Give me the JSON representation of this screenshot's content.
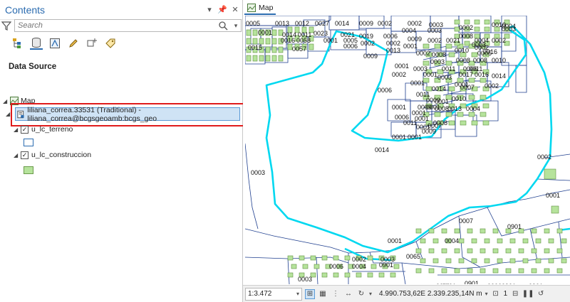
{
  "contents": {
    "title": "Contents",
    "search_placeholder": "Search",
    "section_title": "Data Source",
    "tree": {
      "map_label": "Map",
      "source_label": "liliana_correa.33531 (Traditional) - liliana_correa@bcgsgeoamb:bcgs_geo",
      "layers": [
        {
          "label": "u_lc_terreno",
          "checked": true,
          "symbol": "blue-outline-polygon"
        },
        {
          "label": "u_lc_construccion",
          "checked": true,
          "symbol": "green-fill-polygon"
        }
      ]
    }
  },
  "map": {
    "tab_label": "Map",
    "labels": [
      "0005",
      "0013",
      "0012",
      "0027",
      "0014",
      "0009",
      "0002",
      "0002",
      "0003",
      "0001",
      "0014",
      "0011",
      "0023",
      "0021",
      "0019",
      "0006",
      "0004",
      "0003",
      "0002",
      "0010",
      "0016",
      "0058",
      "0001",
      "0005",
      "0002",
      "0002",
      "0009",
      "0002",
      "0021",
      "0008",
      "0004",
      "0002",
      "0015",
      "0057",
      "0006",
      "0013",
      "0001",
      "0002",
      "0008",
      "0010",
      "0005",
      "0004",
      "0003",
      "0003",
      "0002",
      "0016",
      "0008",
      "0008",
      "0010",
      "0003",
      "0009",
      "0006",
      "0011",
      "0001",
      "0003",
      "0011",
      "0017",
      "0016",
      "0014",
      "0002",
      "0001",
      "0003",
      "0001",
      "0002",
      "0001",
      "0014",
      "0007",
      "0011",
      "0009",
      "0001",
      "0010",
      "0001",
      "0009",
      "0001",
      "0008",
      "0013",
      "0004",
      "0001",
      "0006",
      "0001",
      "0011",
      "0008",
      "0007",
      "0001",
      "0009",
      "0001",
      "0001",
      "0014",
      "0003",
      "0001",
      "0002",
      "0007",
      "0901",
      "0001",
      "0004",
      "0002",
      "0003",
      "0065",
      "0006",
      "0004",
      "0901",
      "0003",
      "0001",
      "0901",
      "0901",
      "0006",
      "0901",
      "0901",
      "0006"
    ],
    "status": {
      "scale": "1:3.472",
      "coordinates": "4.990.753,62E 2.339.235,14N m",
      "selected_count": "1"
    },
    "colors": {
      "parcel_line": "#1f3f8f",
      "boundary": "#00d8f0",
      "building_fill": "#b6e39c",
      "building_stroke": "#5f8f40",
      "accent": "#2b6cb0",
      "highlight": "#e01b1b"
    }
  }
}
